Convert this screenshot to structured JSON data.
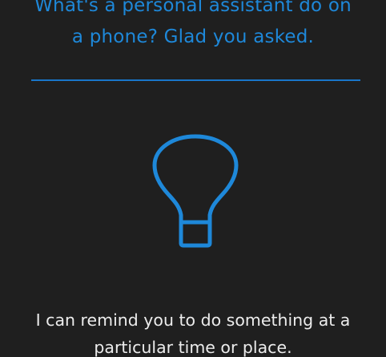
{
  "header": {
    "title_line1": "What's a personal assistant do on",
    "title_line2": "a phone? Glad you asked."
  },
  "main": {
    "icon": "lightbulb-icon",
    "message_line1": "I can remind you to do something at a",
    "message_line2": "particular time or place."
  },
  "colors": {
    "background": "#1f1f1f",
    "accent": "#1e88d9",
    "text": "#ececec"
  }
}
